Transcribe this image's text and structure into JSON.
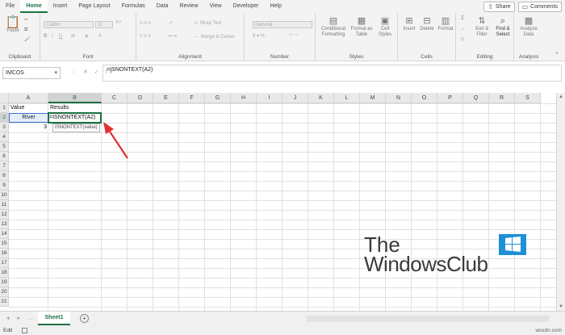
{
  "ribbon_tabs": [
    "File",
    "Home",
    "Insert",
    "Page Layout",
    "Formulas",
    "Data",
    "Review",
    "View",
    "Developer",
    "Help"
  ],
  "top_buttons": {
    "share": "Share",
    "comments": "Comments"
  },
  "groups": {
    "clipboard": {
      "name": "Clipboard",
      "paste": "Paste"
    },
    "font": {
      "name": "Font",
      "font_name": "Calibri",
      "font_size": "11"
    },
    "alignment": {
      "name": "Alignment",
      "wrap": "Wrap Text",
      "merge": "Merge & Center"
    },
    "number": {
      "name": "Number",
      "format": "General"
    },
    "styles": {
      "name": "Styles",
      "cond1": "Conditional",
      "cond2": "Formatting",
      "fmt1": "Format as",
      "fmt2": "Table",
      "cs1": "Cell",
      "cs2": "Styles"
    },
    "cells": {
      "name": "Cells",
      "insert": "Insert",
      "delete": "Delete",
      "format": "Format"
    },
    "editing": {
      "name": "Editing",
      "sort1": "Sort &",
      "sort2": "Filter",
      "find1": "Find &",
      "find2": "Select"
    },
    "analysis": {
      "name": "Analysis",
      "a1": "Analyze",
      "a2": "Data"
    }
  },
  "name_box": "IMCOS",
  "formula": "=ISNONTEXT(A2)",
  "columns": [
    "A",
    "B",
    "C",
    "D",
    "E",
    "F",
    "G",
    "H",
    "I",
    "J",
    "K",
    "L",
    "M",
    "N",
    "O",
    "P",
    "Q",
    "R",
    "S"
  ],
  "rows": [
    "1",
    "2",
    "3",
    "4",
    "5",
    "6",
    "7",
    "8",
    "9",
    "10",
    "11",
    "12",
    "13",
    "14",
    "15",
    "16",
    "17",
    "18",
    "19",
    "20",
    "21"
  ],
  "cells": {
    "a1": "Value",
    "b1": "Results",
    "a2": "River",
    "b2": "=ISNONTEXT(A2)",
    "a3": "3"
  },
  "tooltip": "ISNONTEXT(value)",
  "watermark": {
    "line1": "The",
    "line2": "WindowsClub"
  },
  "sheet_tab": "Sheet1",
  "status": "Edit",
  "credit": "wsxdn.com",
  "colors": {
    "accent": "#1e7145",
    "arrow": "#e03030",
    "logo": "#1e8fd6"
  }
}
